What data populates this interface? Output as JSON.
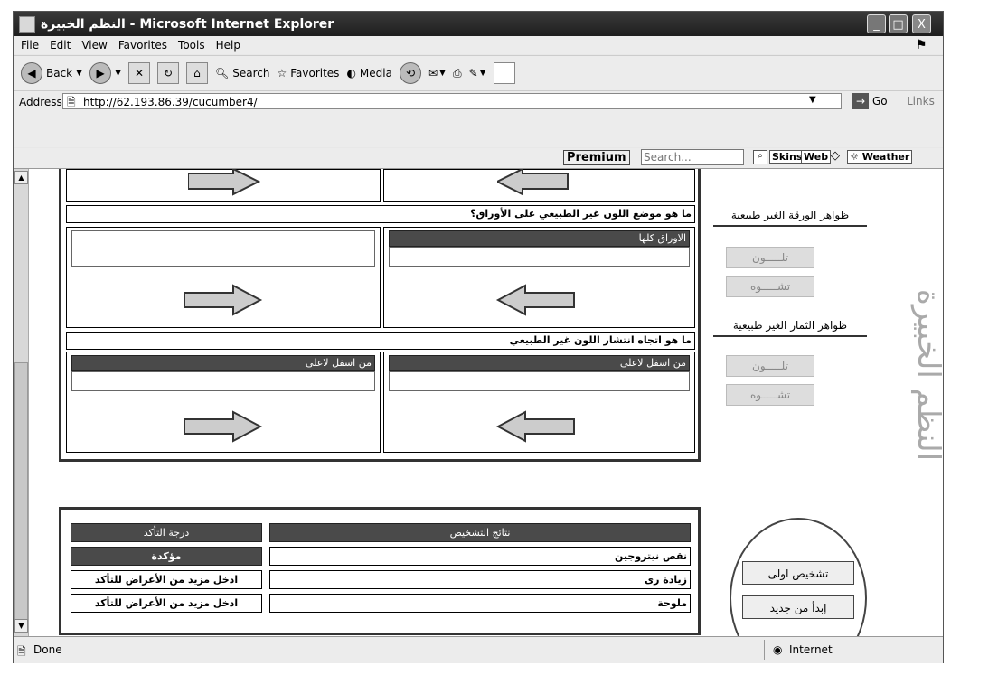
{
  "window": {
    "title": "النظم الخبيرة - Microsoft Internet Explorer",
    "min": "_",
    "max": "□",
    "close": "X"
  },
  "menu": [
    "File",
    "Edit",
    "View",
    "Favorites",
    "Tools",
    "Help"
  ],
  "toolbar": {
    "back": "Back",
    "search": "Search",
    "favorites": "Favorites",
    "media": "Media"
  },
  "address": {
    "label": "Address",
    "url": "http://62.193.86.39/cucumber4/",
    "go": "Go",
    "links": "Links"
  },
  "secondbar": {
    "premium": "Premium",
    "search_placeholder": "Search...",
    "skins": "Skins",
    "web": "Web",
    "weather": "Weather"
  },
  "main": {
    "q1": "ما هو موضع اللون غير الطبيعي على الأوراق؟",
    "q1_right_head": "الاوراق كلها",
    "q2": "ما هو اتجاه انتشار اللون غير الطبيعي",
    "q2_left_head": "من اسفل لاعلى",
    "q2_right_head": "من اسفل لاعلى"
  },
  "results": {
    "col_diag": "نتائج التشخيص",
    "col_conf": "درجة التأكد",
    "rows": [
      {
        "diag": "نقص نيتروجين",
        "conf": "مؤكدة"
      },
      {
        "diag": "زيادة رى",
        "conf": "ادخل مزيد من الأعراض للتأكد"
      },
      {
        "diag": "ملوحة",
        "conf": "ادخل مزيد من الأعراض للتأكد"
      }
    ]
  },
  "sidebar": {
    "leaf_title": "ظواهر الورقة الغير طبيعية",
    "leaf_color": "تلـــــون",
    "leaf_deform": "تشـــــوه",
    "fruit_title": "ظواهر الثمار الغير طبيعية",
    "fruit_color": "تلـــــون",
    "fruit_deform": "تشـــــوه",
    "vertical_title": "النظم الخبيرة"
  },
  "actions": {
    "initial": "تشخيص اولى",
    "restart": "إبدأ من جديد"
  },
  "status": {
    "done": "Done",
    "zone": "Internet"
  }
}
